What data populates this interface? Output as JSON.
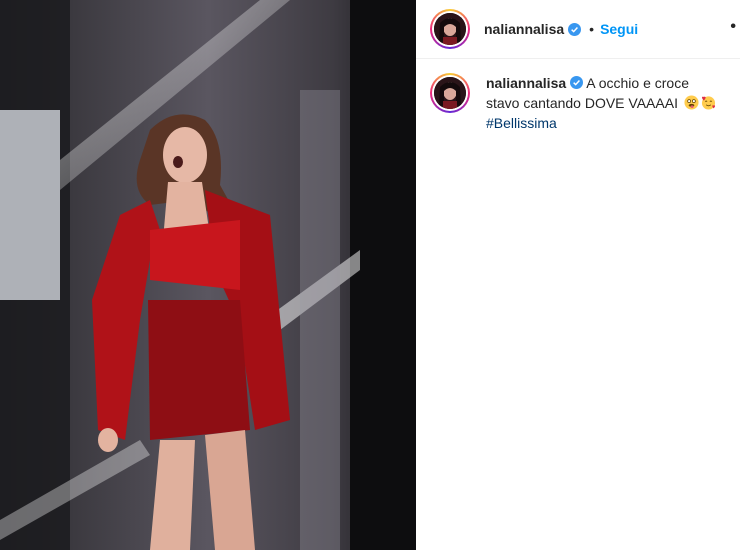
{
  "post": {
    "image_alt": "Performer in red outfit on stage",
    "header": {
      "username": "naliannalisa",
      "separator": "•",
      "follow_label": "Segui",
      "more_icon": "•"
    },
    "caption": {
      "username": "naliannalisa",
      "text": "A occhio e croce stavo cantando DOVE VAAAAI",
      "emojis": [
        "tongue-out-emoji",
        "smiling-hearts-emoji"
      ],
      "hashtag": "#Bellissima"
    },
    "colors": {
      "follow": "#0095f6",
      "hashtag": "#00376b",
      "verified": "#3897f0"
    }
  }
}
